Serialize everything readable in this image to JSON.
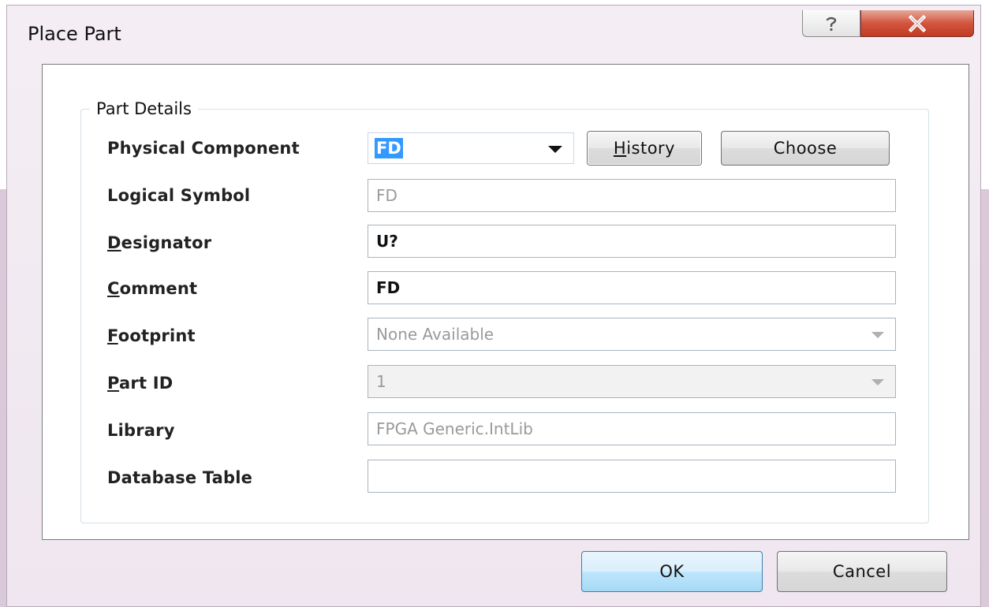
{
  "window": {
    "title": "Place Part",
    "help_icon": "question-mark-icon",
    "close_icon": "close-x-icon"
  },
  "group": {
    "legend": "Part Details"
  },
  "fields": {
    "physical_component": {
      "label": "Physical Component",
      "value": "FD"
    },
    "logical_symbol": {
      "label": "Logical Symbol",
      "value": "FD"
    },
    "designator": {
      "label_accel": "D",
      "label_rest": "esignator",
      "value": "U?"
    },
    "comment": {
      "label_accel": "C",
      "label_rest": "omment",
      "value": "FD"
    },
    "footprint": {
      "label_accel": "F",
      "label_rest": "ootprint",
      "value": "None Available"
    },
    "part_id": {
      "label_accel": "P",
      "label_rest": "art ID",
      "value": "1"
    },
    "library": {
      "label": "Library",
      "value": "FPGA Generic.IntLib"
    },
    "database_table": {
      "label": "Database Table",
      "value": ""
    }
  },
  "buttons": {
    "history_accel": "H",
    "history_rest": "istory",
    "choose": "Choose",
    "ok": "OK",
    "cancel": "Cancel"
  }
}
